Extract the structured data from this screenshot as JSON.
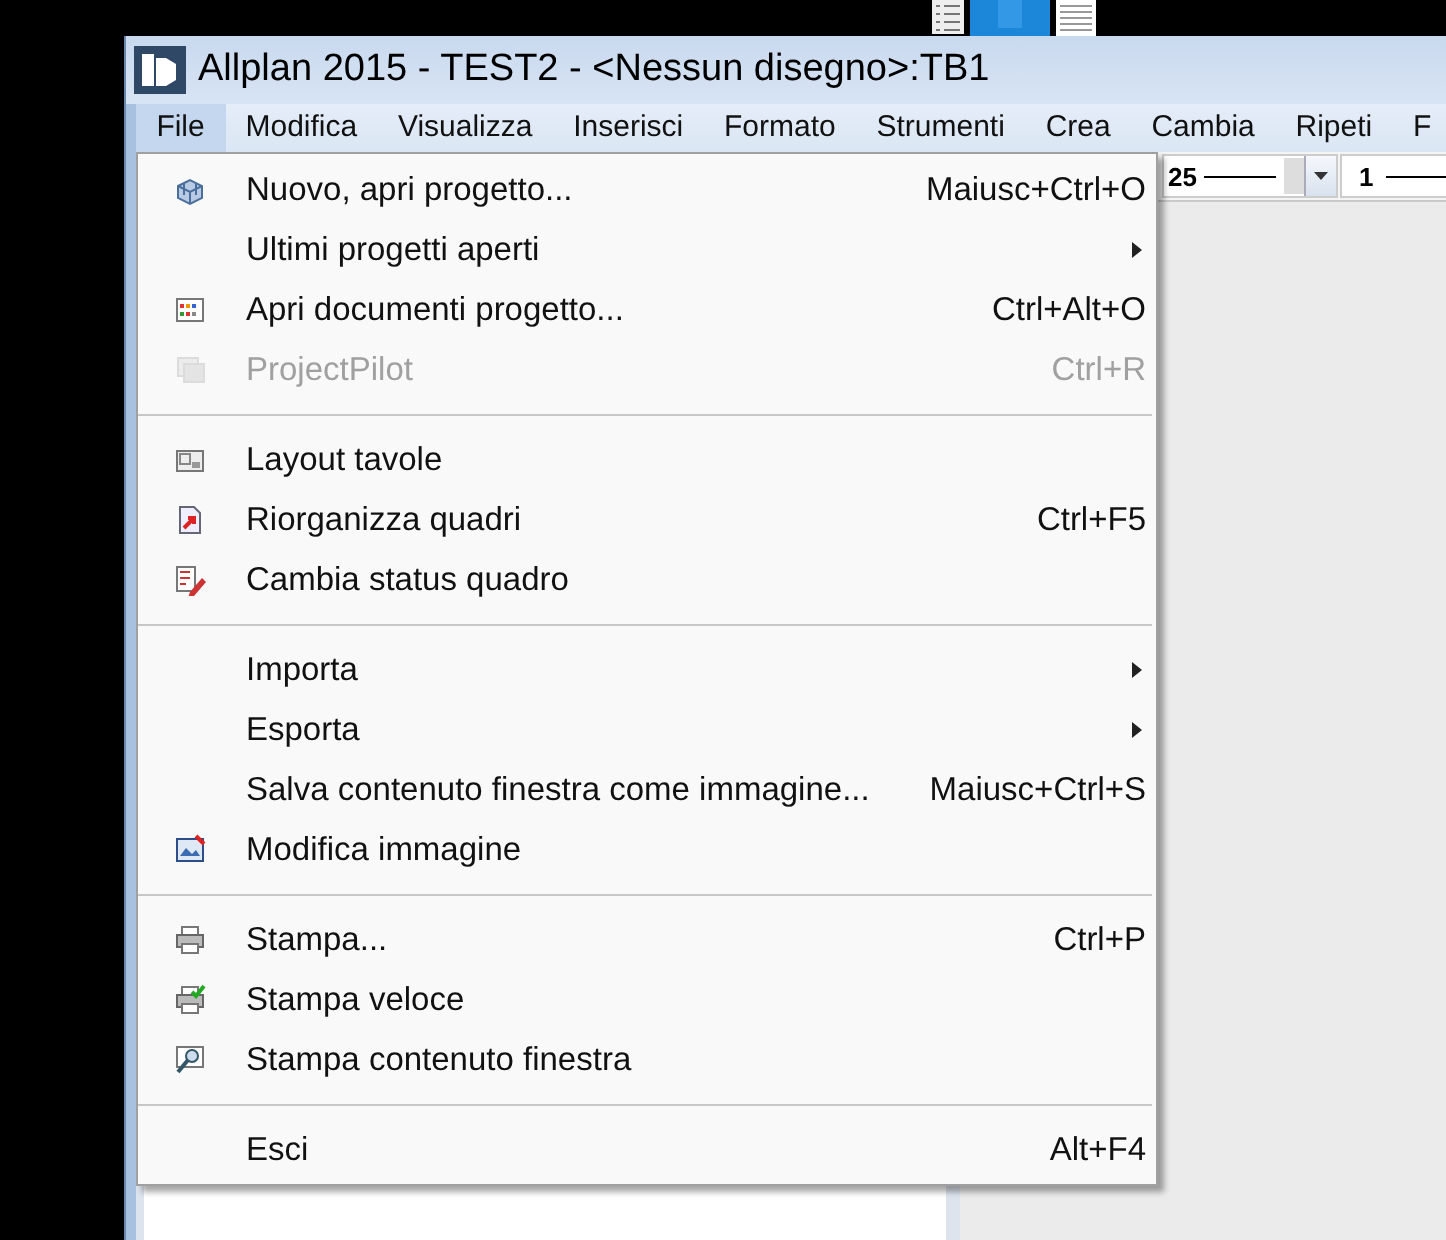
{
  "window": {
    "title": "Allplan 2015 - TEST2 - <Nessun disegno>:TB1"
  },
  "menu_bar": [
    {
      "label": "File",
      "selected": true
    },
    {
      "label": "Modifica",
      "selected": false
    },
    {
      "label": "Visualizza",
      "selected": false
    },
    {
      "label": "Inserisci",
      "selected": false
    },
    {
      "label": "Formato",
      "selected": false
    },
    {
      "label": "Strumenti",
      "selected": false
    },
    {
      "label": "Crea",
      "selected": false
    },
    {
      "label": "Cambia",
      "selected": false
    },
    {
      "label": "Ripeti",
      "selected": false
    },
    {
      "label": "F",
      "selected": false
    }
  ],
  "toolbar": {
    "pen_combo": "25",
    "line_combo": "1"
  },
  "file_menu": [
    {
      "kind": "item",
      "label": "Nuovo, apri progetto...",
      "shortcut": "Maiusc+Ctrl+O",
      "disabled": false
    },
    {
      "kind": "submenu",
      "label": "Ultimi progetti aperti",
      "disabled": false
    },
    {
      "kind": "item",
      "label": "Apri documenti progetto...",
      "shortcut": "Ctrl+Alt+O",
      "disabled": false
    },
    {
      "kind": "item",
      "label": "ProjectPilot",
      "shortcut": "Ctrl+R",
      "disabled": true
    },
    {
      "kind": "separator"
    },
    {
      "kind": "item",
      "label": "Layout tavole",
      "disabled": false
    },
    {
      "kind": "item",
      "label": "Riorganizza quadri",
      "shortcut": "Ctrl+F5",
      "disabled": false
    },
    {
      "kind": "item",
      "label": "Cambia status quadro",
      "disabled": false
    },
    {
      "kind": "separator"
    },
    {
      "kind": "submenu",
      "label": "Importa",
      "disabled": false
    },
    {
      "kind": "submenu",
      "label": "Esporta",
      "disabled": false
    },
    {
      "kind": "item",
      "label": "Salva contenuto finestra come immagine...",
      "shortcut": "Maiusc+Ctrl+S",
      "disabled": false
    },
    {
      "kind": "item",
      "label": "Modifica immagine",
      "disabled": false
    },
    {
      "kind": "separator"
    },
    {
      "kind": "item",
      "label": "Stampa...",
      "shortcut": "Ctrl+P",
      "disabled": false
    },
    {
      "kind": "item",
      "label": "Stampa veloce",
      "disabled": false
    },
    {
      "kind": "item",
      "label": "Stampa contenuto finestra",
      "disabled": false
    },
    {
      "kind": "separator"
    },
    {
      "kind": "item",
      "label": "Esci",
      "shortcut": "Alt+F4",
      "disabled": false
    }
  ]
}
